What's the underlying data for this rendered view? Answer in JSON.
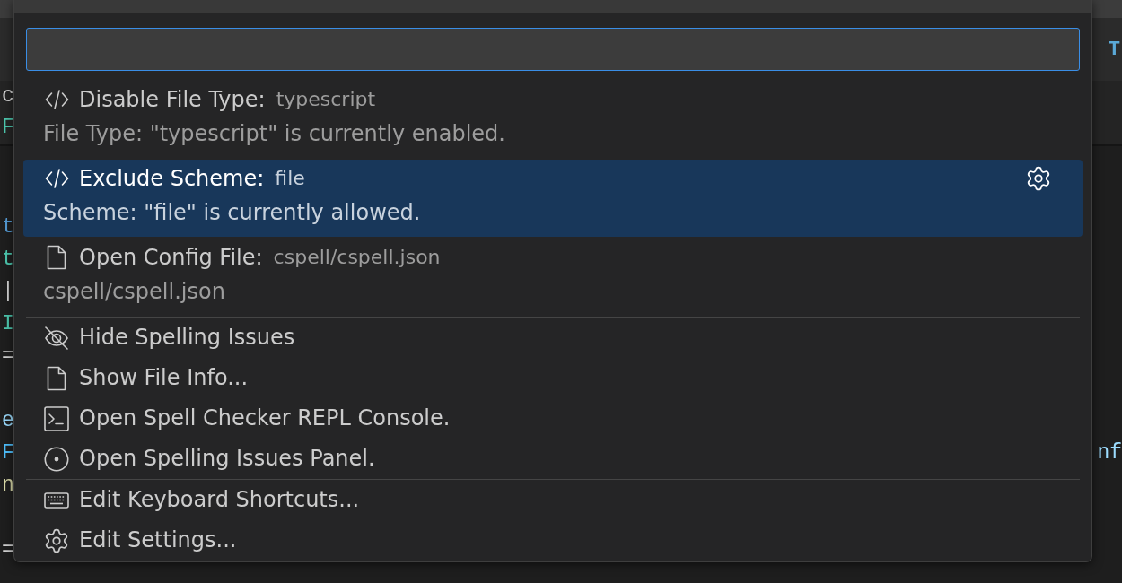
{
  "editor": {
    "tab_fragment": "T",
    "sticky_lines": [
      {
        "left": {
          "text": "c",
          "kind": "plain"
        }
      },
      {
        "left": {
          "text": "F",
          "kind": "type"
        }
      }
    ],
    "code_blocks": [
      {
        "lines": [
          {
            "left": {
              "text": "t",
              "kind": "keyword"
            }
          },
          {
            "left": {
              "text": "t",
              "kind": "type"
            }
          },
          {
            "left": {
              "text": "|",
              "kind": "plain"
            }
          },
          {
            "left": {
              "text": "I",
              "kind": "type"
            }
          },
          {
            "left": {
              "text": "=",
              "kind": "plain"
            }
          }
        ]
      },
      {
        "lines": [
          {
            "left": {
              "text": "e",
              "kind": "variable"
            }
          },
          {
            "left": {
              "text": "F",
              "kind": "constant"
            },
            "right": {
              "text": "nf",
              "kind": "variable"
            }
          },
          {
            "left": {
              "text": "n",
              "kind": "function"
            }
          }
        ]
      },
      {
        "lines": [
          {
            "left": {
              "text": "=",
              "kind": "plain"
            }
          }
        ]
      }
    ]
  },
  "quick_pick": {
    "input": {
      "focused": true
    },
    "groups": [
      {
        "items": [
          {
            "label": "Disable File Type:",
            "detail": "typescript",
            "description": "File Type: \"typescript\" is currently enabled.",
            "selected": false
          },
          {
            "label": "Exclude Scheme:",
            "detail": "file",
            "description": "Scheme: \"file\" is currently allowed.",
            "selected": true
          },
          {
            "label": "Open Config File:",
            "detail": "cspell/cspell.json",
            "description": "cspell/cspell.json",
            "selected": false
          }
        ]
      },
      {
        "items": [
          {
            "label": "Hide Spelling Issues",
            "selected": false
          },
          {
            "label": "Show File Info...",
            "selected": false
          },
          {
            "label": "Open Spell Checker REPL Console.",
            "selected": false
          },
          {
            "label": "Open Spelling Issues Panel.",
            "selected": false
          }
        ]
      },
      {
        "items": [
          {
            "label": "Edit Keyboard Shortcuts...",
            "selected": false
          },
          {
            "label": "Edit Settings...",
            "selected": false
          }
        ]
      }
    ]
  }
}
